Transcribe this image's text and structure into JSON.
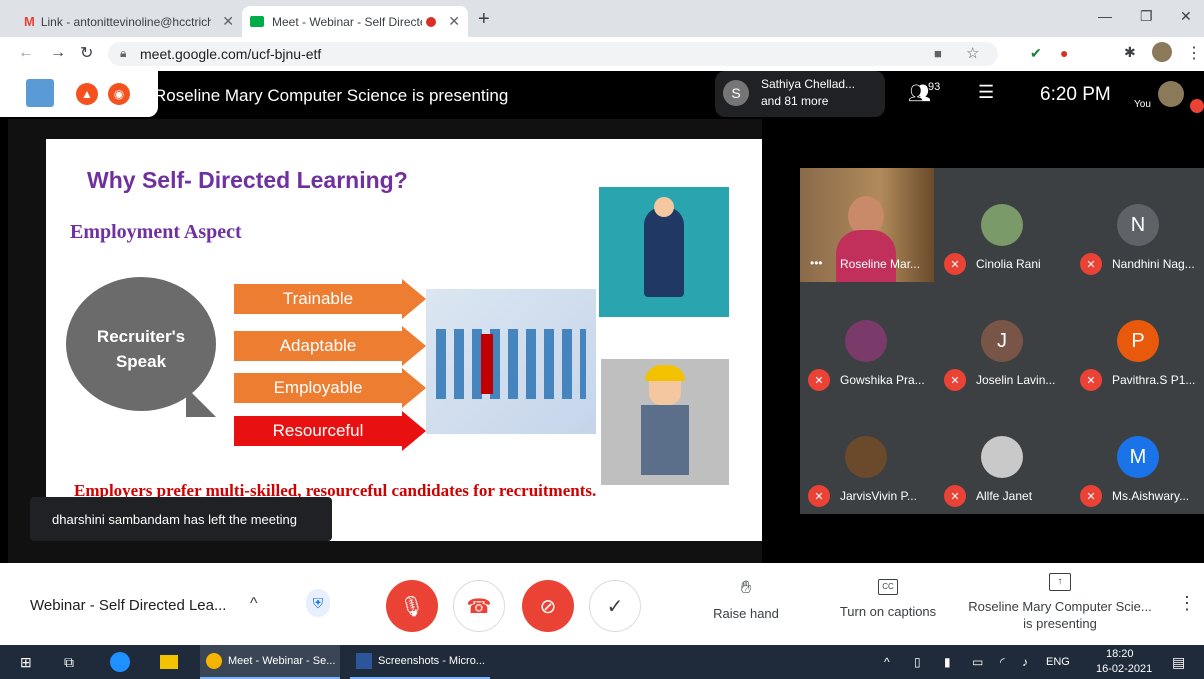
{
  "browser": {
    "tabs": [
      {
        "label": "Link - antonittevinoline@hcctrich",
        "icon": "gmail-icon"
      },
      {
        "label": "Meet - Webinar - Self Directe",
        "icon": "meet-icon"
      }
    ],
    "url": "meet.google.com/ucf-bjnu-etf"
  },
  "meet": {
    "presenting_banner": "Roseline Mary Computer Science is presenting",
    "participants_chip": {
      "initial": "S",
      "line1": "Sathiya Chellad...",
      "line2": "and 81 more"
    },
    "people_count": "93",
    "clock": "6:20 PM",
    "self_label": "You",
    "toast": "dharshini sambandam has left the meeting",
    "tiles": [
      {
        "name": "Roseline Mar...",
        "initial": "",
        "color": "#8a6a4a",
        "muted": false
      },
      {
        "name": "Cinolia Rani",
        "initial": "",
        "color": "#7a9a6a",
        "muted": true
      },
      {
        "name": "Nandhini Nag...",
        "initial": "N",
        "color": "#5f6368",
        "muted": true
      },
      {
        "name": "Gowshika Pra...",
        "initial": "",
        "color": "#7a3a6a",
        "muted": true
      },
      {
        "name": "Joselin Lavin...",
        "initial": "J",
        "color": "#795548",
        "muted": true
      },
      {
        "name": "Pavithra.S P1...",
        "initial": "P",
        "color": "#e8590c",
        "muted": true
      },
      {
        "name": "JarvisVivin P...",
        "initial": "",
        "color": "#6a4a2a",
        "muted": true
      },
      {
        "name": "Allfe Janet",
        "initial": "",
        "color": "#c9c9c9",
        "muted": true
      },
      {
        "name": "Ms.Aishwary...",
        "initial": "M",
        "color": "#1a73e8",
        "muted": true
      }
    ]
  },
  "slide": {
    "title": "Why Self- Directed Learning?",
    "subtitle": "Employment Aspect",
    "bubble": [
      "Recruiter's",
      "Speak"
    ],
    "arrows": [
      {
        "label": "Trainable",
        "color": "#ed7d31"
      },
      {
        "label": "Adaptable",
        "color": "#ed7d31"
      },
      {
        "label": "Employable",
        "color": "#ed7d31"
      },
      {
        "label": "Resourceful",
        "color": "#e81010"
      }
    ],
    "footer": "Employers prefer multi-skilled, resourceful candidates for recruitments."
  },
  "bottom": {
    "meeting_title": "Webinar - Self Directed Lea...",
    "raise_hand": "Raise hand",
    "captions": "Turn on captions",
    "presenting_line1": "Roseline Mary Computer Scie...",
    "presenting_line2": "is presenting"
  },
  "taskbar": {
    "apps": [
      {
        "label": "Meet - Webinar - Se...",
        "icon": "chrome-icon"
      },
      {
        "label": "Screenshots - Micro...",
        "icon": "word-icon"
      }
    ],
    "lang": "ENG",
    "time": "18:20",
    "date": "16-02-2021"
  }
}
